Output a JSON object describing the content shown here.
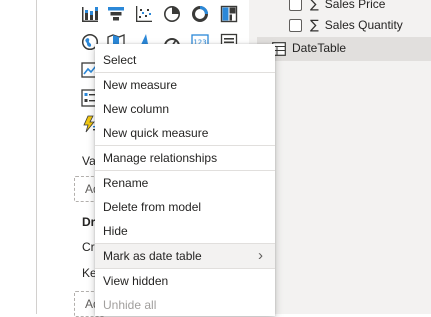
{
  "visualizations_pane": {
    "wells": [
      {
        "label": "Va",
        "placeholder": "Ad"
      },
      {
        "label": "Dr",
        "sublabel": "Cr"
      },
      {
        "label": "Ke",
        "placeholder": "Ad"
      }
    ],
    "icons": [
      "stacked-column-icon",
      "funnel-icon",
      "scatter-icon",
      "pie-icon",
      "donut-icon",
      "treemap-icon",
      "map-icon",
      "filled-map-icon",
      "shape-map-icon",
      "gauge-icon",
      "card-icon",
      "multirow-card-icon",
      "kpi-icon",
      "slicer-icon",
      "table-icon",
      "matrix-icon",
      "key-influencers-icon"
    ]
  },
  "fields_pane": {
    "fields": [
      {
        "name": "Sales Price",
        "symbol": "∑"
      },
      {
        "name": "Sales Quantity",
        "symbol": "∑"
      }
    ],
    "selected_table": {
      "name": "DateTable",
      "expand": "›"
    }
  },
  "context_menu": {
    "items": [
      {
        "label": "Select"
      },
      {
        "label": "New measure"
      },
      {
        "label": "New column"
      },
      {
        "label": "New quick measure"
      },
      {
        "label": "Manage relationships"
      },
      {
        "label": "Rename"
      },
      {
        "label": "Delete from model"
      },
      {
        "label": "Hide"
      },
      {
        "label": "Mark as date table",
        "submenu_arrow": "›"
      },
      {
        "label": "View hidden"
      },
      {
        "label": "Unhide all"
      }
    ]
  },
  "colors": {
    "accent_blue": "#2b88d8",
    "icon_dark": "#3a3a38",
    "selected_row": "#e1dfdd",
    "menu_hover": "#f3f2f1"
  }
}
